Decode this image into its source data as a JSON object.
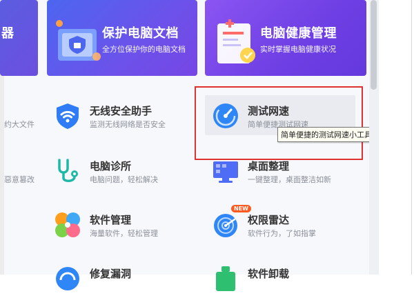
{
  "banners": [
    {
      "title": "器",
      "subtitle": ""
    },
    {
      "title": "保护电脑文档",
      "subtitle": "全方位保护你的电脑文档"
    },
    {
      "title": "电脑健康管理",
      "subtitle": "实时掌握电脑健康状况"
    }
  ],
  "left_partial": {
    "row1": "约大文件",
    "row2": "惡意篡改"
  },
  "tools": [
    {
      "name": "无线安全助手",
      "desc": "监测无线网络是否安全",
      "icon": "wifi-shield-icon"
    },
    {
      "name": "测试网速",
      "desc": "简单便捷测试网速",
      "icon": "speedometer-icon"
    },
    {
      "name": "电脑诊所",
      "desc": "电脑问题，轻松解决",
      "icon": "stethoscope-icon"
    },
    {
      "name": "桌面整理",
      "desc": "一键整理，桌面整洁如新",
      "icon": "monitor-icon"
    },
    {
      "name": "软件管理",
      "desc": "海量软件，轻松管理",
      "icon": "clover-icon"
    },
    {
      "name": "权限雷达",
      "desc": "软件行为，了如指掌",
      "icon": "radar-icon",
      "badge": "NEW"
    },
    {
      "name": "修复漏洞",
      "desc": "",
      "icon": "repair-icon"
    },
    {
      "name": "软件卸载",
      "desc": "",
      "icon": "uninstall-icon"
    }
  ],
  "tooltip": "简单便捷的测试网速小工具",
  "colors": {
    "accent": "#4c66f0",
    "highlight_border": "#e03131",
    "new_badge": "#ff5a1f"
  }
}
